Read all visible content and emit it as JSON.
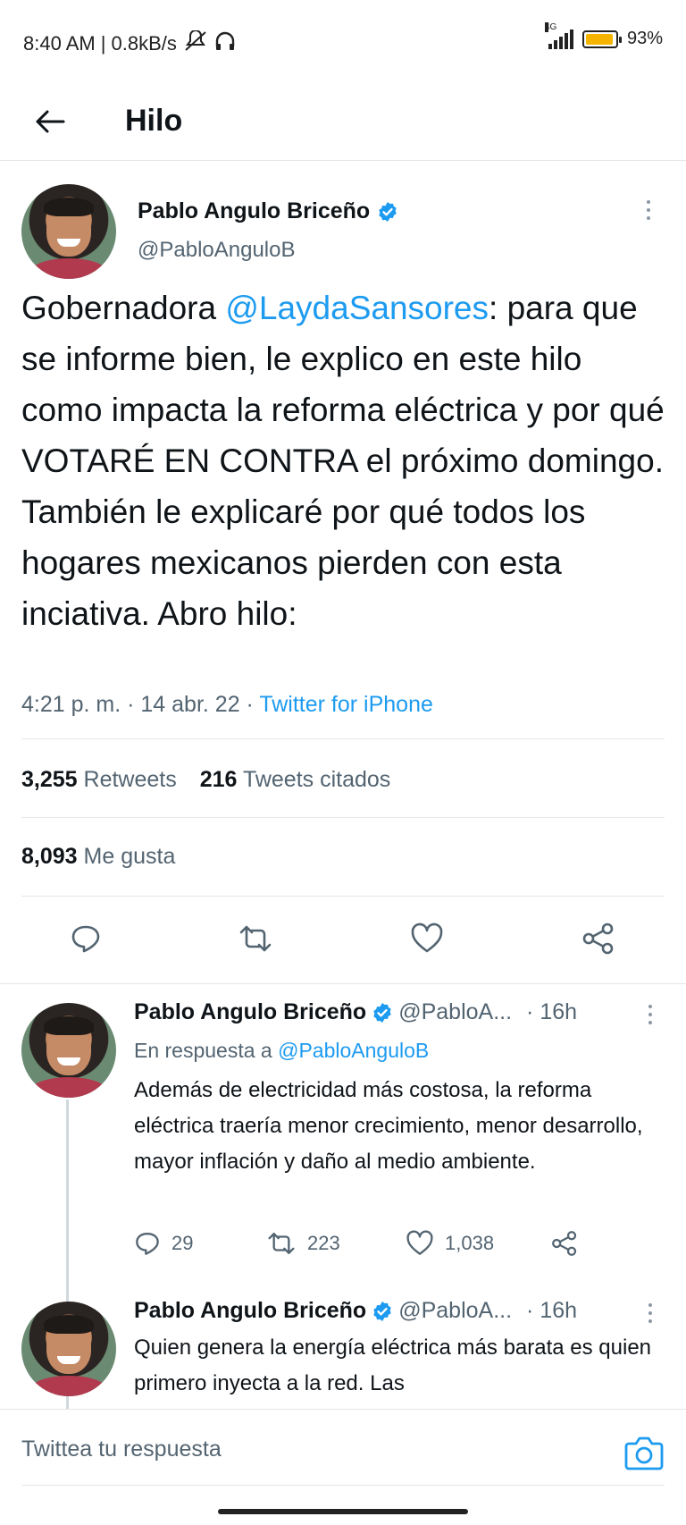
{
  "status_bar": {
    "time": "8:40 AM",
    "speed": "| 0.8kB/s",
    "network": "4G",
    "battery_text": "93%",
    "battery_level": 0.93
  },
  "header": {
    "title": "Hilo"
  },
  "main_tweet": {
    "name": "Pablo Angulo Briceño",
    "handle": "@PabloAnguloB",
    "text_parts": [
      "Gobernadora ",
      "@LaydaSansores",
      ": para que se informe bien, le explico en este hilo como impacta la reforma eléctrica y por qué VOTARÉ EN CONTRA el próximo domingo. También le explicaré por qué todos los hogares mexicanos pierden con esta inciativa. Abro hilo:"
    ],
    "meta_time": "4:21 p. m. · 14 abr. 22 · ",
    "meta_source": "Twitter for iPhone",
    "retweets_count": "3,255",
    "retweets_label": "Retweets",
    "quotes_count": "216",
    "quotes_label": "Tweets citados",
    "likes_count": "8,093",
    "likes_label": "Me gusta"
  },
  "replies": [
    {
      "name": "Pablo Angulo Briceño",
      "handle": "@PabloA...",
      "time": "· 16h",
      "in_reply_prefix": "En respuesta a ",
      "in_reply_handle": "@PabloAnguloB",
      "text": "Además de electricidad más costosa, la reforma eléctrica traería menor crecimiento, menor desarrollo, mayor inflación y daño al medio ambiente.",
      "replies": "29",
      "retweets": "223",
      "likes": "1,038"
    },
    {
      "name": "Pablo Angulo Briceño",
      "handle": "@PabloA...",
      "time": "· 16h",
      "text": "Quien genera la energía eléctrica más barata es quien primero inyecta a la red. Las"
    }
  ],
  "compose": {
    "placeholder": "Twittea tu respuesta"
  },
  "colors": {
    "accent": "#1d9bf0",
    "muted": "#536471",
    "text": "#0f1419"
  }
}
